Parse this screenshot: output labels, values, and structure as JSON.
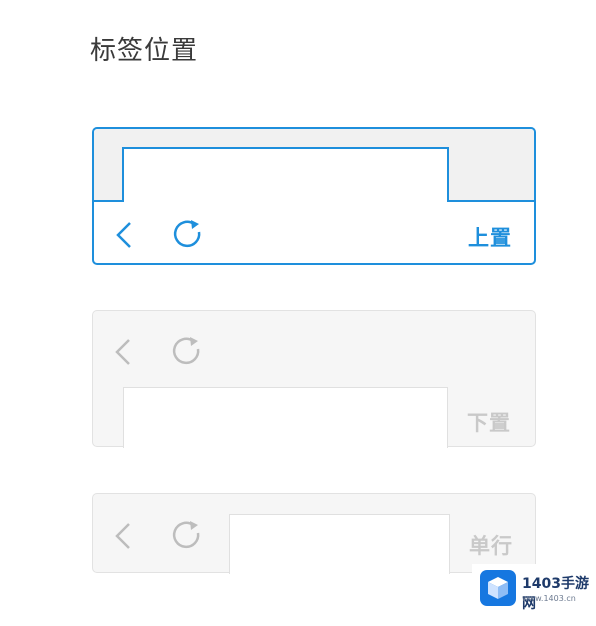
{
  "page": {
    "title": "标签位置"
  },
  "options": {
    "top": {
      "label": "上置"
    },
    "bottom": {
      "label": "下置"
    },
    "single": {
      "label": "单行"
    }
  },
  "watermark": {
    "brand": "1403手游网",
    "url": "www.1403.cn"
  },
  "colors": {
    "accent": "#1e8fdc",
    "inactive": "#c9c9c9",
    "panel": "#f6f6f6"
  }
}
